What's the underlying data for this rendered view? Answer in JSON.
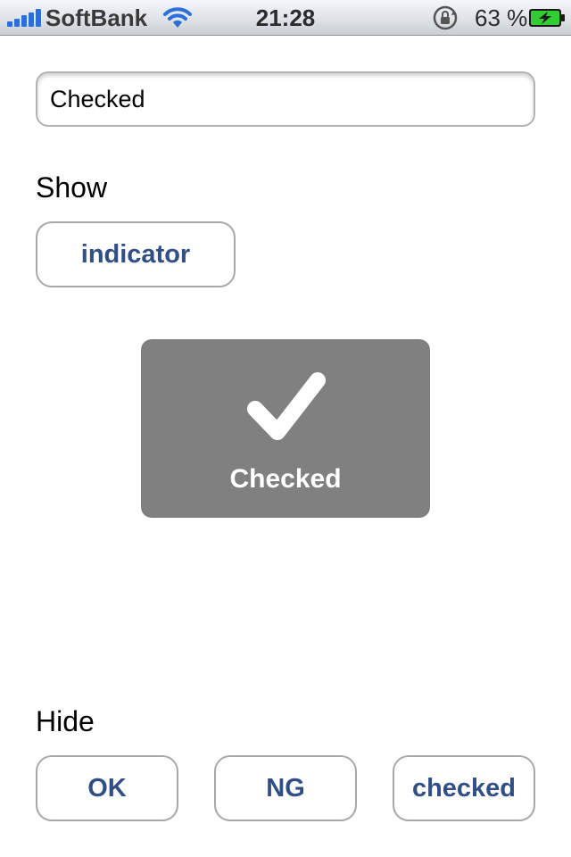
{
  "status_bar": {
    "carrier": "SoftBank",
    "time": "21:28",
    "battery_percent": "63 %",
    "icons": [
      "signal-icon",
      "wifi-icon",
      "rotation-lock-icon",
      "battery-charging-icon"
    ],
    "signal_color": "#2c6fd8",
    "battery_color": "#33cc33"
  },
  "text_field": {
    "value": "Checked"
  },
  "show_section": {
    "label": "Show",
    "indicator_button": "indicator"
  },
  "hud": {
    "icon": "checkmark-icon",
    "label": "Checked",
    "background": "#808080"
  },
  "hide_section": {
    "label": "Hide",
    "buttons": [
      "OK",
      "NG",
      "checked"
    ]
  },
  "colors": {
    "button_text": "#324f85",
    "button_border": "#a8a8a8"
  }
}
